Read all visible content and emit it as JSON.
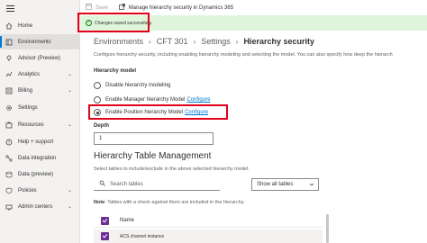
{
  "sidebar": {
    "items": [
      {
        "label": "Home",
        "icon": "home-icon"
      },
      {
        "label": "Environments",
        "icon": "environments-icon",
        "active": true
      },
      {
        "label": "Advisor (Preview)",
        "icon": "advisor-icon"
      },
      {
        "label": "Analytics",
        "icon": "analytics-icon",
        "expandable": true
      },
      {
        "label": "Billing",
        "icon": "billing-icon",
        "expandable": true
      },
      {
        "label": "Settings",
        "icon": "settings-icon"
      },
      {
        "label": "Resources",
        "icon": "resources-icon",
        "expandable": true
      },
      {
        "label": "Help + support",
        "icon": "help-icon"
      },
      {
        "label": "Data integration",
        "icon": "data-integration-icon"
      },
      {
        "label": "Data (preview)",
        "icon": "data-preview-icon"
      },
      {
        "label": "Policies",
        "icon": "policies-icon",
        "expandable": true
      },
      {
        "label": "Admin centers",
        "icon": "admin-centers-icon",
        "expandable": true
      }
    ]
  },
  "cmdbar": {
    "save_label": "Save",
    "manage_label": "Manage hierarchy security in Dynamics 365"
  },
  "banner": {
    "message": "Changes saved successfully.",
    "color": "#dff6dd"
  },
  "breadcrumb": {
    "items": [
      "Environments",
      "CFT 301",
      "Settings",
      "Hierarchy security"
    ]
  },
  "main": {
    "description": "Configure hierarchy security, including enabling hierarchy modeling and selecting the model. You can also specify how deep the hierarch",
    "model_label": "Hierarchy model",
    "options": [
      {
        "label": "Disable hierarchy modeling",
        "link": "",
        "selected": false
      },
      {
        "label": "Enable Manager hierarchy Model",
        "link": "Configure",
        "selected": false
      },
      {
        "label": "Enable Position hierarchy Model",
        "link": "Configure",
        "selected": true
      }
    ],
    "depth_label": "Depth",
    "depth_value": "1",
    "table_title": "Hierarchy Table Management",
    "table_sub": "Select tables to include/exclude in the above selected hierarchy model.",
    "search_placeholder": "Search tables",
    "filter_value": "Show all tables",
    "note_prefix": "Note",
    "note_text": ": Tables with a check against them are included in the hierarchy.",
    "col_name": "Name",
    "rows": [
      "ACS channel instance"
    ]
  },
  "colors": {
    "accent": "#0078d4",
    "highlight": "#e3001b",
    "checkbox": "#6c2d95"
  }
}
